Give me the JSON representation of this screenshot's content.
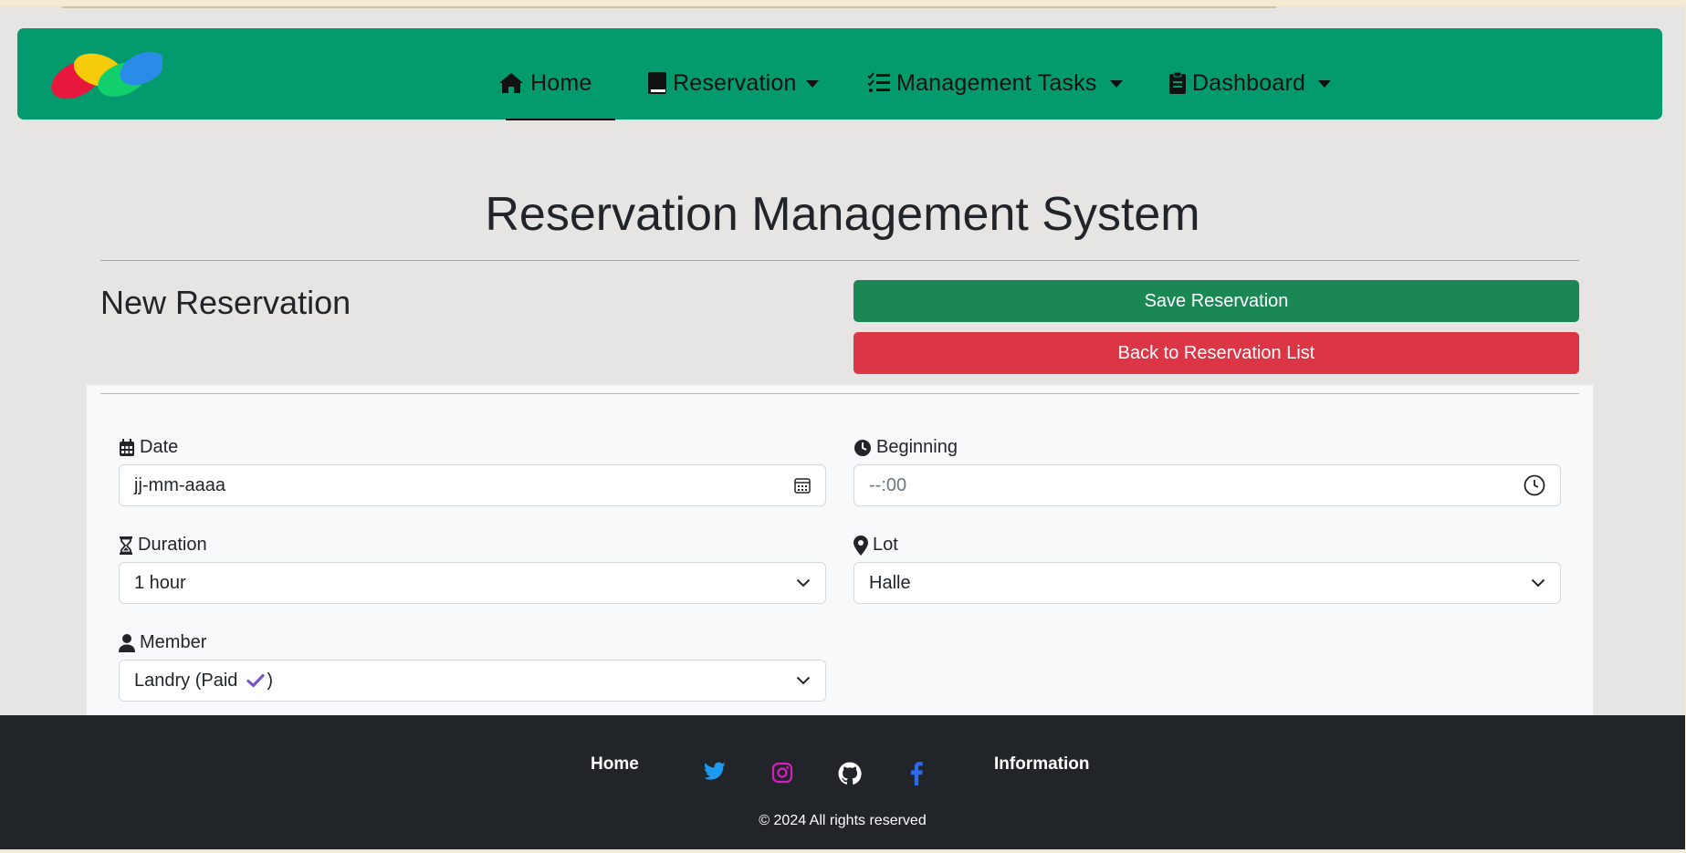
{
  "navbar": {
    "brand": "brand-logo",
    "items": [
      {
        "label": "Home",
        "icon": "home-icon",
        "active": true,
        "dropdown": false
      },
      {
        "label": "Reservation",
        "icon": "book-icon",
        "active": false,
        "dropdown": true
      },
      {
        "label": "Management Tasks",
        "icon": "list-check-icon",
        "active": false,
        "dropdown": true
      },
      {
        "label": "Dashboard",
        "icon": "clipboard-icon",
        "active": false,
        "dropdown": true
      }
    ],
    "background": "#039a6e"
  },
  "page": {
    "title": "Reservation Management System",
    "subtitle": "New Reservation"
  },
  "actions": {
    "save_label": "Save Reservation",
    "back_label": "Back to Reservation List",
    "save_color": "#1b8754",
    "back_color": "#dc3545"
  },
  "form": {
    "date": {
      "label": "Date",
      "placeholder": "jj-mm-aaaa",
      "icon": "calendar-icon"
    },
    "beginning": {
      "label": "Beginning",
      "placeholder": "--:00",
      "icon": "clock-icon"
    },
    "duration": {
      "label": "Duration",
      "value": "1 hour",
      "icon": "hourglass-icon"
    },
    "lot": {
      "label": "Lot",
      "value": "Halle",
      "icon": "map-pin-icon"
    },
    "member": {
      "label": "Member",
      "value_prefix": "Landry (Paid",
      "value_suffix": ")",
      "status_icon": "checkmark-icon",
      "icon": "user-icon"
    }
  },
  "footer": {
    "home_label": "Home",
    "info_label": "Information",
    "social": [
      "twitter-icon",
      "instagram-icon",
      "github-icon",
      "facebook-icon"
    ],
    "copyright": "© 2024 All rights reserved"
  }
}
